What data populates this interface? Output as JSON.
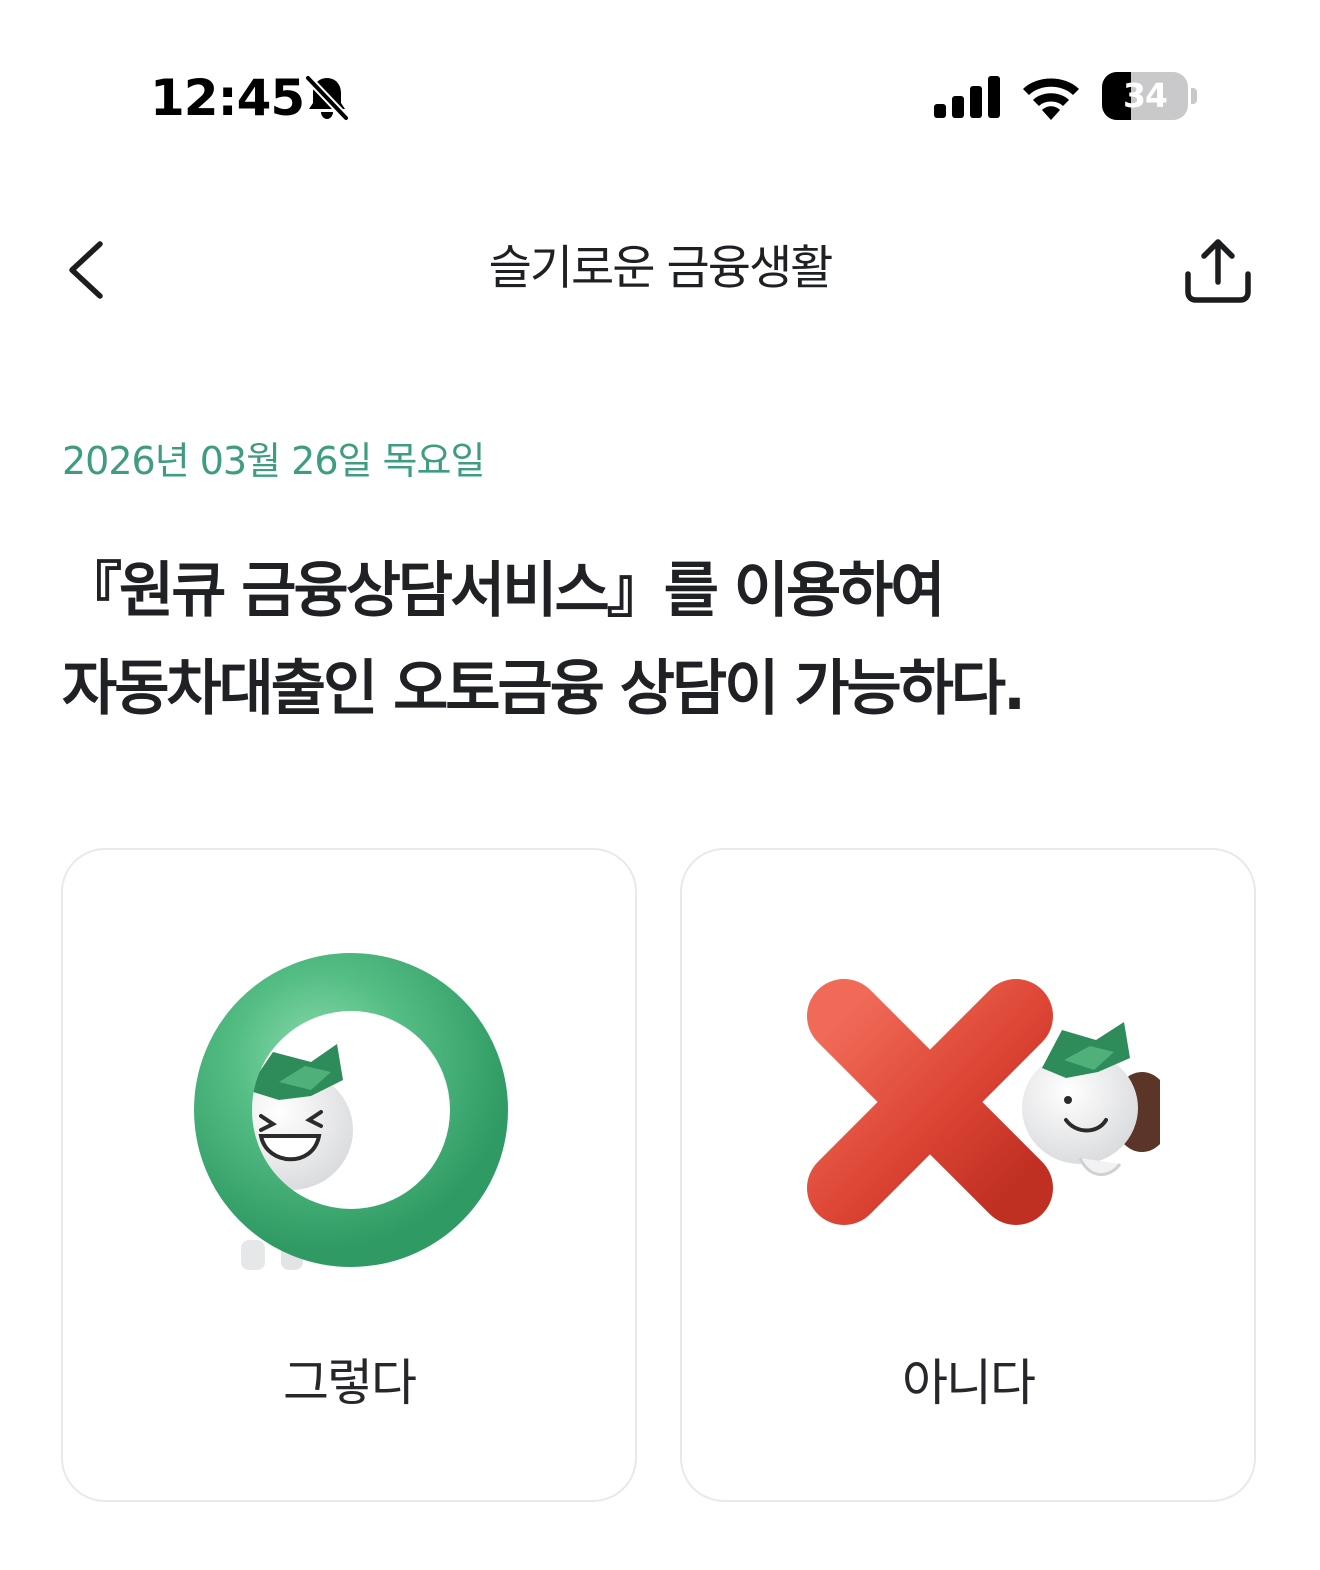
{
  "status_bar": {
    "time": "12:45",
    "silent_icon": "bell-slash-icon",
    "signal_icon": "cellular-signal-icon",
    "wifi_icon": "wifi-icon",
    "battery_level": "34",
    "battery_fraction": 0.34
  },
  "nav": {
    "back_icon": "chevron-left-icon",
    "title": "슬기로운 금융생활",
    "share_icon": "share-upload-icon"
  },
  "quiz": {
    "date": "2026년 03월 26일 목요일",
    "question_lines": [
      "『원큐 금융상담서비스』를 이용하여",
      "자동차대출인 오토금융 상담이 가능하다."
    ]
  },
  "answers": {
    "yes": {
      "label": "그렇다",
      "illustration": "green-o-character-icon",
      "color": "#4cb87f"
    },
    "no": {
      "label": "아니다",
      "illustration": "red-x-character-icon",
      "color": "#e0473a"
    }
  },
  "colors": {
    "accent_green": "#3e9c81",
    "text_primary": "#202124",
    "card_border": "#e8e9eb"
  }
}
